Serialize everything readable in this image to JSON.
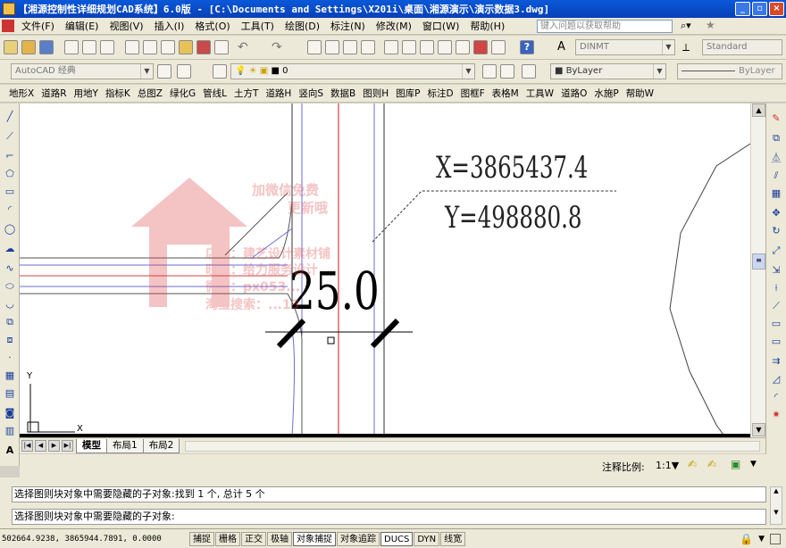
{
  "window": {
    "title": "【湘源控制性详细规划CAD系统】6.0版 - [C:\\Documents and Settings\\X201i\\桌面\\湘源演示\\演示数据3.dwg]",
    "buttons": [
      "_",
      "▫",
      "×"
    ]
  },
  "menu": {
    "items": [
      "文件(F)",
      "编辑(E)",
      "视图(V)",
      "插入(I)",
      "格式(O)",
      "工具(T)",
      "绘图(D)",
      "标注(N)",
      "修改(M)",
      "窗口(W)",
      "帮助(H)"
    ],
    "help_search_placeholder": "键入问题以获取帮助"
  },
  "toolbar_row2": {
    "text_style": "DINMT",
    "dim_style": "Standard"
  },
  "toolbar_row3": {
    "workspace": "AutoCAD 经典",
    "layer": "0",
    "color": "ByLayer",
    "linetype": "ByLayer"
  },
  "menu2": {
    "items": [
      "地形X",
      "道路R",
      "用地Y",
      "指标K",
      "总图Z",
      "绿化G",
      "管线L",
      "土方T",
      "道路H",
      "竖向S",
      "数据B",
      "图则H",
      "图库P",
      "标注D",
      "图框F",
      "表格M",
      "工具W",
      "道路O",
      "水施P",
      "帮助W"
    ]
  },
  "drawing": {
    "coord_x": "X=3865437.4",
    "coord_y": "Y=498880.8",
    "dimension": "25.0",
    "ucs_y": "Y",
    "ucs_x": "X",
    "watermark": {
      "line1": "加微信免费",
      "line2": "更新哦",
      "line3": "店铺：建艺设计素材铺",
      "line4": "旺旺：给力服务设计",
      "line5": "微信：px053...",
      "line6": "淘宝搜索：...13"
    }
  },
  "layout_tabs": [
    "模型",
    "布局1",
    "布局2"
  ],
  "annotation_scale": {
    "label": "注释比例:",
    "value": "1:1▼"
  },
  "command": {
    "history": "选择图则块对象中需要隐藏的子对象:找到 1 个, 总计 5 个",
    "prompt": "选择图则块对象中需要隐藏的子对象:"
  },
  "status": {
    "coords": "502664.9238, 3865944.7891, 0.0000",
    "toggles": [
      {
        "label": "捕捉",
        "on": false
      },
      {
        "label": "栅格",
        "on": false
      },
      {
        "label": "正交",
        "on": false
      },
      {
        "label": "极轴",
        "on": false
      },
      {
        "label": "对象捕捉",
        "on": true
      },
      {
        "label": "对象追踪",
        "on": false
      },
      {
        "label": "DUCS",
        "on": true
      },
      {
        "label": "DYN",
        "on": false
      },
      {
        "label": "线宽",
        "on": false
      }
    ]
  }
}
